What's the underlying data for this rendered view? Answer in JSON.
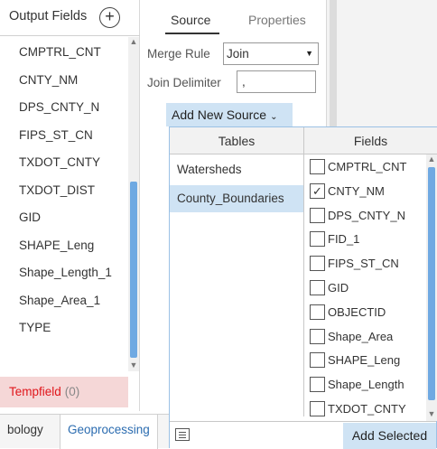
{
  "output_fields": {
    "header_label": "Output Fields",
    "add_symbol": "+",
    "fields": [
      "CMPTRL_CNT",
      "CNTY_NM",
      "DPS_CNTY_N",
      "FIPS_ST_CN",
      "TXDOT_CNTY",
      "TXDOT_DIST",
      "GID",
      "SHAPE_Leng",
      "Shape_Length_1",
      "Shape_Area_1",
      "TYPE"
    ],
    "temp_field": {
      "name": "Tempfield",
      "count": "(0)"
    }
  },
  "source_panel": {
    "tabs": [
      {
        "label": "Source",
        "active": true
      },
      {
        "label": "Properties",
        "active": false
      }
    ],
    "merge_rule_label": "Merge Rule",
    "merge_rule_value": "Join",
    "join_delimiter_label": "Join Delimiter",
    "join_delimiter_value": ",",
    "add_source_label": "Add New Source"
  },
  "add_source_dropdown": {
    "tables_header": "Tables",
    "fields_header": "Fields",
    "tables": [
      {
        "label": "Watersheds",
        "selected": false
      },
      {
        "label": "County_Boundaries",
        "selected": true
      }
    ],
    "fields": [
      {
        "label": "CMPTRL_CNT",
        "checked": false
      },
      {
        "label": "CNTY_NM",
        "checked": true
      },
      {
        "label": "DPS_CNTY_N",
        "checked": false
      },
      {
        "label": "FID_1",
        "checked": false
      },
      {
        "label": "FIPS_ST_CN",
        "checked": false
      },
      {
        "label": "GID",
        "checked": false
      },
      {
        "label": "OBJECTID",
        "checked": false
      },
      {
        "label": "Shape_Area",
        "checked": false
      },
      {
        "label": "SHAPE_Leng",
        "checked": false
      },
      {
        "label": "Shape_Length",
        "checked": false
      },
      {
        "label": "TXDOT_CNTY",
        "checked": false
      }
    ],
    "add_selected_label": "Add Selected"
  },
  "bottom_tabs": [
    "bology",
    "Geoprocessing"
  ],
  "icons": {
    "add_field": "plus-circle-icon",
    "dropdown_arrow": "caret-down-icon",
    "chevron": "chevron-down-icon",
    "checkmark": "check-icon",
    "list_view": "list-icon"
  },
  "colors": {
    "selection_blue": "#cfe3f4",
    "scroll_thumb": "#6fa9e2",
    "temp_field_text": "#e0161b",
    "temp_field_bg": "#f5d7d7",
    "link_blue": "#2b6cb0"
  }
}
